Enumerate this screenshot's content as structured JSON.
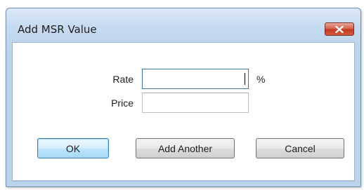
{
  "dialog": {
    "title": "Add MSR Value",
    "close_icon": "close-x-icon"
  },
  "form": {
    "rate": {
      "label": "Rate",
      "value": "",
      "unit": "%"
    },
    "price": {
      "label": "Price",
      "value": ""
    }
  },
  "buttons": {
    "ok": "OK",
    "add_another": "Add Another",
    "cancel": "Cancel"
  },
  "colors": {
    "title_bar": "#c7dbf0",
    "close_button": "#c9432b",
    "focus_border": "#3d7bad"
  }
}
